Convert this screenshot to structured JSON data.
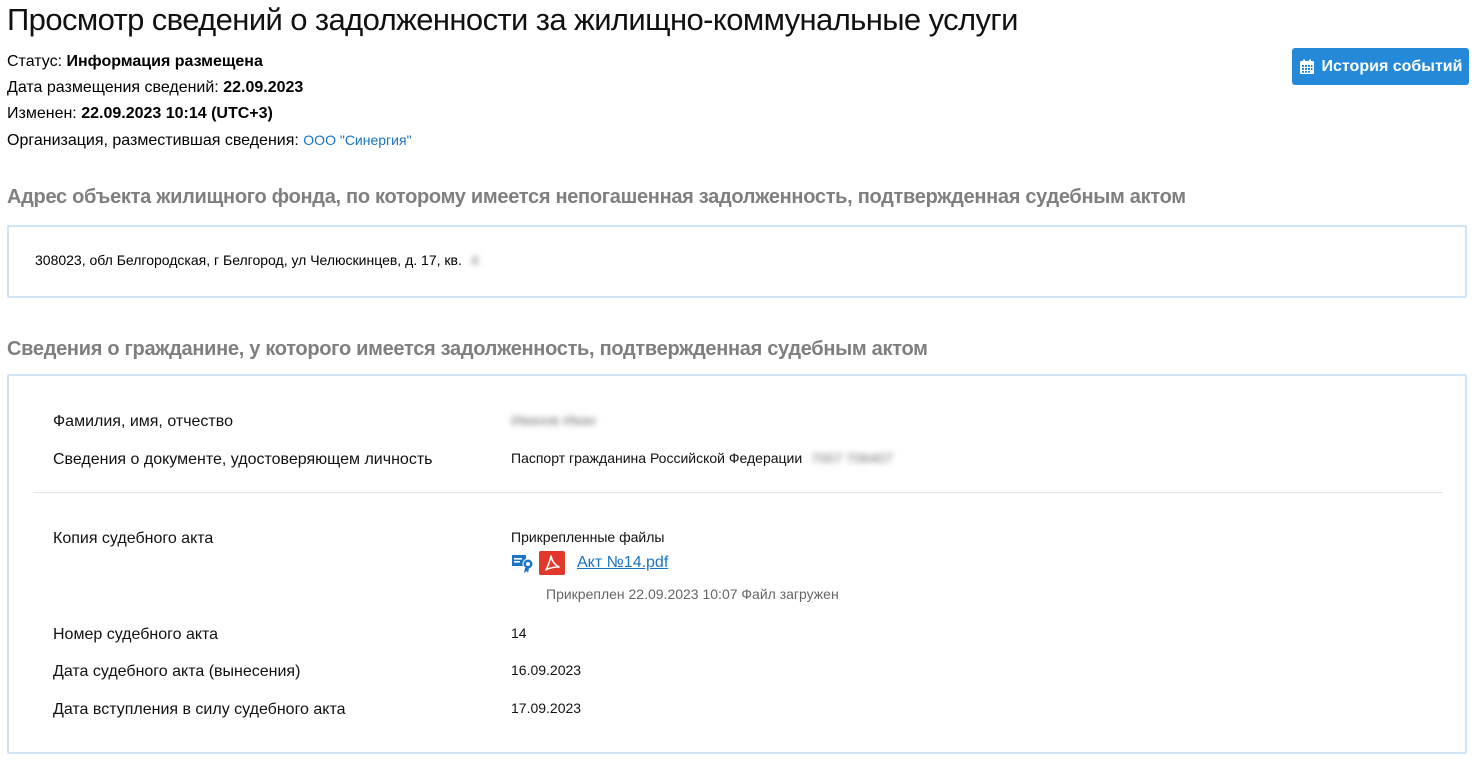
{
  "page": {
    "title": "Просмотр сведений о задолженности за жилищно-коммунальные услуги"
  },
  "meta": {
    "status_label": "Статус:",
    "status_value": "Информация размещена",
    "date_label": "Дата размещения сведений:",
    "date_value": "22.09.2023",
    "changed_label": "Изменен:",
    "changed_value": "22.09.2023 10:14 (UTC+3)",
    "org_label": "Организация, разместившая сведения:",
    "org_value": "ООО \"Синергия\""
  },
  "toolbar": {
    "history_label": "История событий",
    "history_icon": "calendar-icon"
  },
  "address_section": {
    "title": "Адрес объекта жилищного фонда, по которому имеется непогашенная задолженность, подтвержденная судебным актом",
    "address": "308023, обл Белгородская, г Белгород, ул Челюскинцев, д. 17, кв.",
    "address_hidden": "4"
  },
  "citizen_section": {
    "title": "Сведения о гражданине, у которого имеется задолженность, подтвержденная судебным актом",
    "fio_label": "Фамилия, имя, отчество",
    "fio_value": "Иванов Иван",
    "doc_label": "Сведения о документе, удостоверяющем личность",
    "doc_value": "Паспорт гражданина Российской Федерации",
    "doc_number": "7007 706407",
    "copy_label": "Копия судебного акта",
    "files_label": "Прикрепленные файлы",
    "file_name": "Акт №14.pdf",
    "file_note": "Прикреплен 22.09.2023 10:07 Файл загружен",
    "number_label": "Номер судебного акта",
    "number_value": "14",
    "date_label": "Дата судебного акта (вынесения)",
    "date_value": "16.09.2023",
    "effective_label": "Дата вступления в силу судебного акта",
    "effective_value": "17.09.2023"
  },
  "colors": {
    "accent": "#2589d9",
    "link": "#1a73c5",
    "section_title": "#7f7f7f",
    "box_border": "#cfe4f4",
    "pdf_red": "#e2382b"
  }
}
